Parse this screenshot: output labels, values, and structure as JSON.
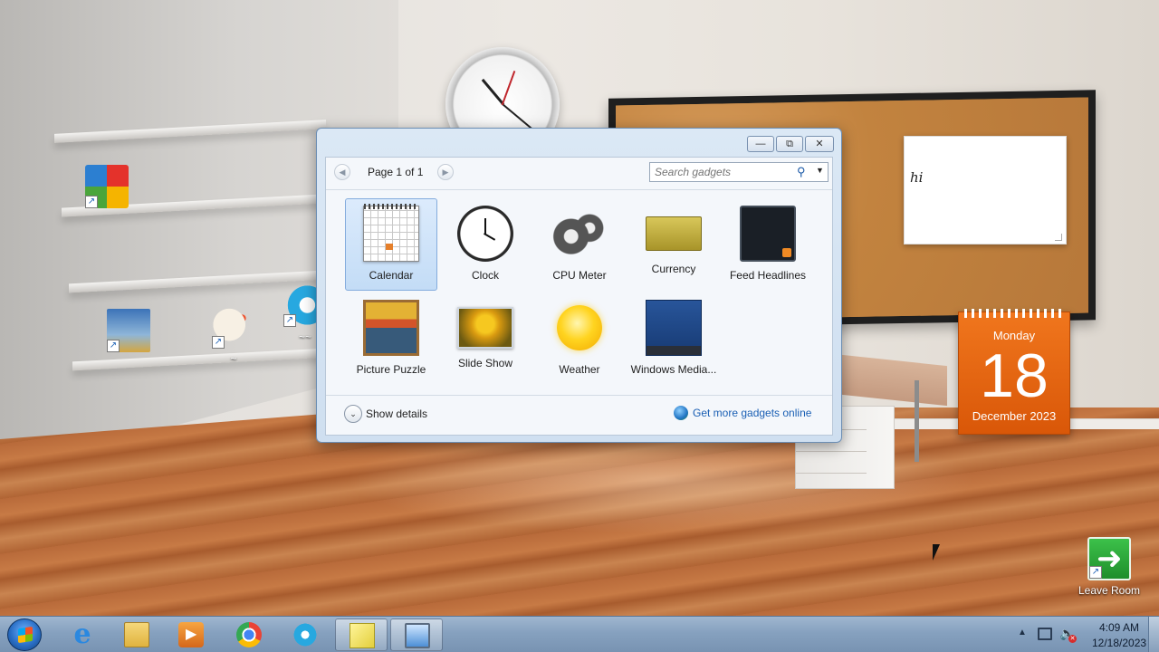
{
  "desktop": {
    "icons": [
      {
        "label": "",
        "icon": "avg-antivirus-icon"
      },
      {
        "label": "",
        "icon": "pubg-game-icon"
      },
      {
        "label": "~",
        "icon": "paint-icon"
      },
      {
        "label": "~~",
        "icon": "kodi-icon"
      },
      {
        "label": "Leave Room",
        "icon": "leave-room-icon"
      }
    ],
    "sticky_note": {
      "text": "hi"
    },
    "calendar_gadget": {
      "weekday": "Monday",
      "day": "18",
      "month_year": "December 2023",
      "color": "#e8650f"
    }
  },
  "gadget_window": {
    "controls": {
      "minimize": "—",
      "restore": "⧉",
      "close": "✕"
    },
    "pager": {
      "label": "Page 1 of 1",
      "prev": "◀",
      "next": "▶"
    },
    "search": {
      "placeholder": "Search gadgets",
      "icon": "search-icon",
      "dropdown": "▼"
    },
    "gadgets": [
      {
        "name": "Calendar",
        "selected": true
      },
      {
        "name": "Clock",
        "selected": false
      },
      {
        "name": "CPU Meter",
        "selected": false
      },
      {
        "name": "Currency",
        "selected": false
      },
      {
        "name": "Feed Headlines",
        "selected": false
      },
      {
        "name": "Picture Puzzle",
        "selected": false
      },
      {
        "name": "Slide Show",
        "selected": false
      },
      {
        "name": "Weather",
        "selected": false
      },
      {
        "name": "Windows Media...",
        "selected": false
      }
    ],
    "footer": {
      "show_details": "Show details",
      "expand_glyph": "⌄",
      "get_more": "Get more gadgets online"
    },
    "accent_color": "#1a5fb4"
  },
  "taskbar": {
    "pinned": [
      {
        "name": "Internet Explorer",
        "icon": "internet-explorer-icon",
        "glyph": "e"
      },
      {
        "name": "Windows Explorer",
        "icon": "folder-icon"
      },
      {
        "name": "Windows Media Player",
        "icon": "media-player-icon"
      },
      {
        "name": "Google Chrome",
        "icon": "chrome-icon"
      },
      {
        "name": "Kodi",
        "icon": "kodi-icon"
      },
      {
        "name": "Sticky Notes",
        "icon": "sticky-notes-icon",
        "active": true
      },
      {
        "name": "Desktop Gadget Gallery",
        "icon": "gadgets-icon",
        "active": true
      }
    ],
    "tray": {
      "overflow": "▲",
      "volume_glyph": "🔈",
      "muted_glyph": "✕",
      "time": "4:09 AM",
      "date": "12/18/2023"
    }
  }
}
